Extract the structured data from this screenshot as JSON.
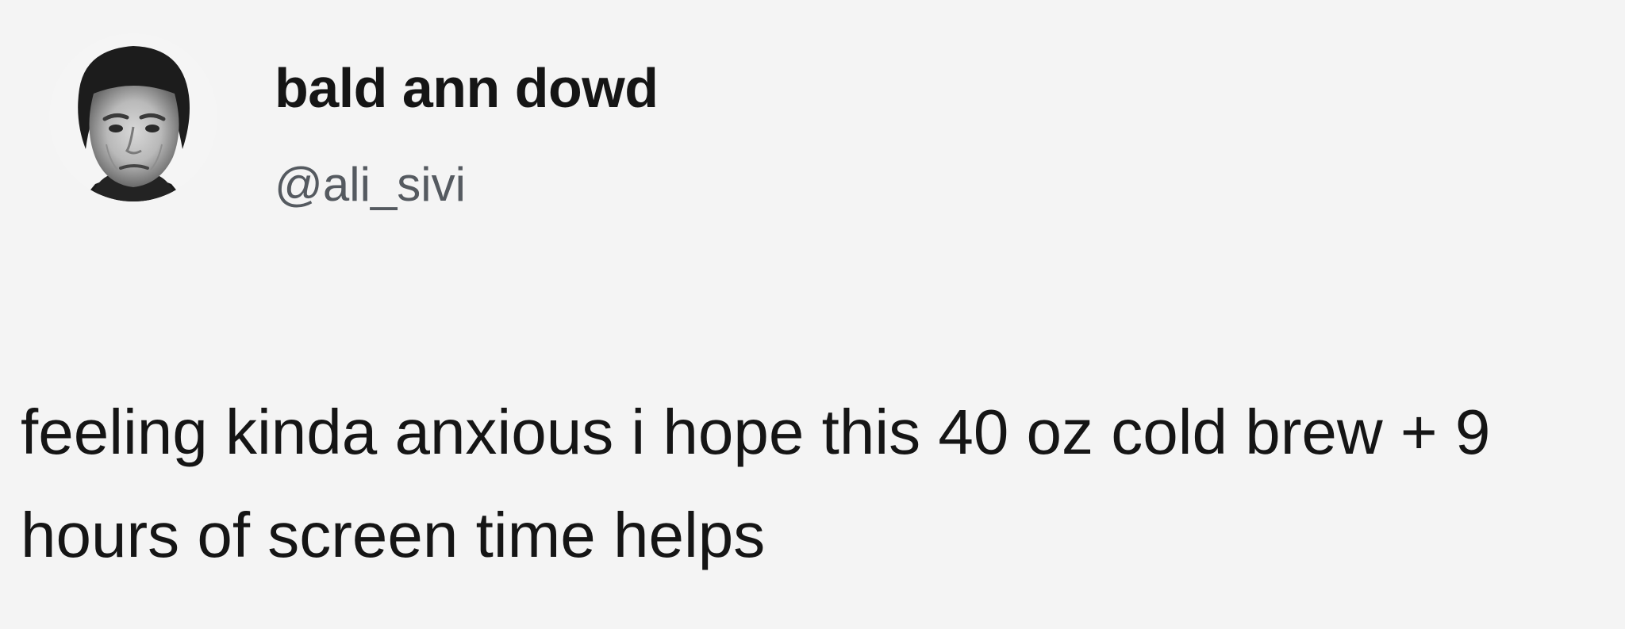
{
  "tweet": {
    "author": {
      "display_name": "bald ann dowd",
      "handle": "@ali_sivi",
      "avatar_icon": "profile-photo-avatar"
    },
    "text": "feeling kinda anxious i hope this 40 oz cold brew + 9 hours of screen time helps"
  },
  "colors": {
    "background": "#f4f4f4",
    "primary_text": "#151515",
    "secondary_text": "#555a60"
  }
}
